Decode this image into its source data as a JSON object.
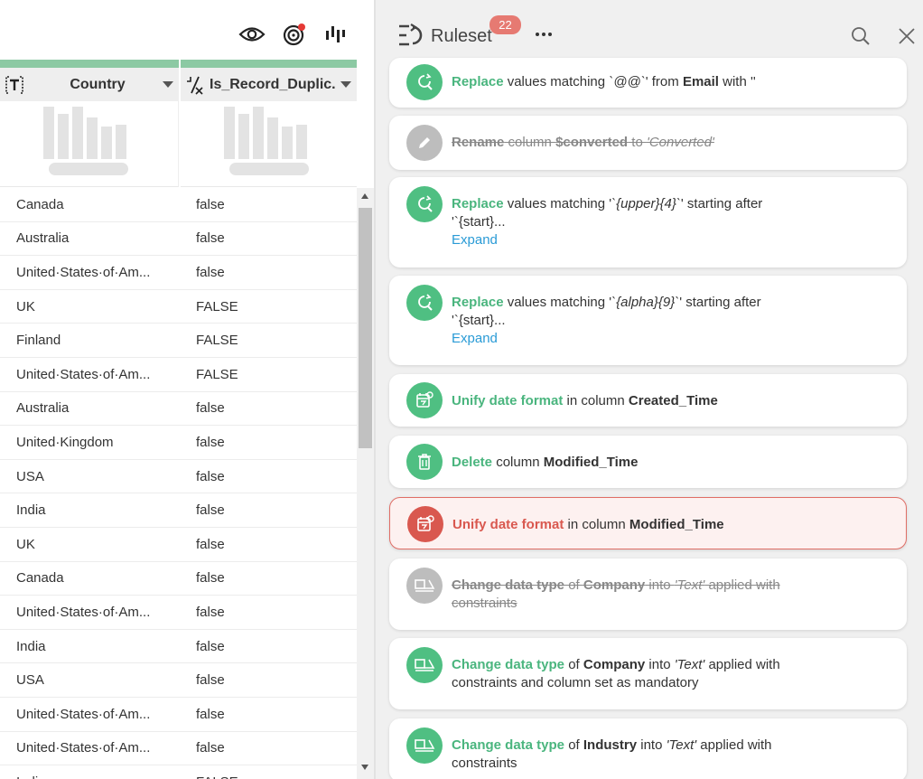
{
  "toolbar": {
    "icons": [
      "eye-icon",
      "target-icon",
      "insights-icon"
    ],
    "target_dot_color": "#e53935"
  },
  "columns": [
    {
      "name": "Country",
      "type_icon": "text-type-icon",
      "type_glyph": "[T]"
    },
    {
      "name": "Is_Record_Duplic...",
      "type_icon": "boolean-type-icon",
      "type_glyph": "⁄ₓ"
    }
  ],
  "rows": [
    [
      "Canada",
      "false"
    ],
    [
      "Australia",
      "false"
    ],
    [
      "United·States·of·Am...",
      "false"
    ],
    [
      "UK",
      "FALSE"
    ],
    [
      "Finland",
      "FALSE"
    ],
    [
      "United·States·of·Am...",
      "FALSE"
    ],
    [
      "Australia",
      "false"
    ],
    [
      "United·Kingdom",
      "false"
    ],
    [
      "USA",
      "false"
    ],
    [
      "India",
      "false"
    ],
    [
      "UK",
      "false"
    ],
    [
      "Canada",
      "false"
    ],
    [
      "United·States·of·Am...",
      "false"
    ],
    [
      "India",
      "false"
    ],
    [
      "USA",
      "false"
    ],
    [
      "United·States·of·Am...",
      "false"
    ],
    [
      "United·States·of·Am...",
      "false"
    ],
    [
      "India",
      "FALSE"
    ]
  ],
  "ruleset": {
    "title": "Ruleset",
    "count": "22",
    "rules": [
      {
        "icon": "replace-icon",
        "state": "normal",
        "action": "Replace",
        "parts": [
          " values matching ",
          "`@@`",
          "' from ",
          "Email",
          " with ''"
        ],
        "expand": ""
      },
      {
        "icon": "rename-icon",
        "state": "off",
        "action": "Rename",
        "parts": [
          " column ",
          "$converted",
          " to ",
          "'Converted'",
          ""
        ],
        "expand": ""
      },
      {
        "icon": "replace-icon",
        "state": "normal",
        "action": "Replace",
        "parts": [
          " values matching '",
          "`{upper}{4}`",
          "' starting after",
          "",
          " '`{start}..."
        ],
        "expand": "Expand"
      },
      {
        "icon": "replace-icon",
        "state": "normal",
        "action": "Replace",
        "parts": [
          " values matching '",
          "`{alpha}{9}`",
          "' starting after",
          "",
          " '`{start}..."
        ],
        "expand": "Expand"
      },
      {
        "icon": "date-format-icon",
        "state": "normal",
        "action": "Unify date format",
        "parts": [
          " in column ",
          "Created_Time",
          "",
          "",
          ""
        ],
        "expand": ""
      },
      {
        "icon": "delete-icon",
        "state": "normal",
        "action": "Delete",
        "parts": [
          " column ",
          "Modified_Time",
          "",
          "",
          ""
        ],
        "expand": ""
      },
      {
        "icon": "date-format-icon",
        "state": "active",
        "action": "Unify date format",
        "parts": [
          " in column ",
          "Modified_Time",
          "",
          "",
          ""
        ],
        "expand": ""
      },
      {
        "icon": "data-type-icon",
        "state": "off",
        "action": "Change data type",
        "parts": [
          " of ",
          "Company",
          " into ",
          "'Text'",
          " applied with constraints"
        ],
        "expand": ""
      },
      {
        "icon": "data-type-icon",
        "state": "normal",
        "action": "Change data type",
        "parts": [
          " of ",
          "Company",
          " into ",
          "'Text'",
          " applied with constraints and column set as mandatory"
        ],
        "expand": ""
      },
      {
        "icon": "data-type-icon",
        "state": "normal",
        "action": "Change data type",
        "parts": [
          " of ",
          "Industry",
          " into ",
          "'Text'",
          " applied with constraints"
        ],
        "expand": ""
      }
    ]
  }
}
